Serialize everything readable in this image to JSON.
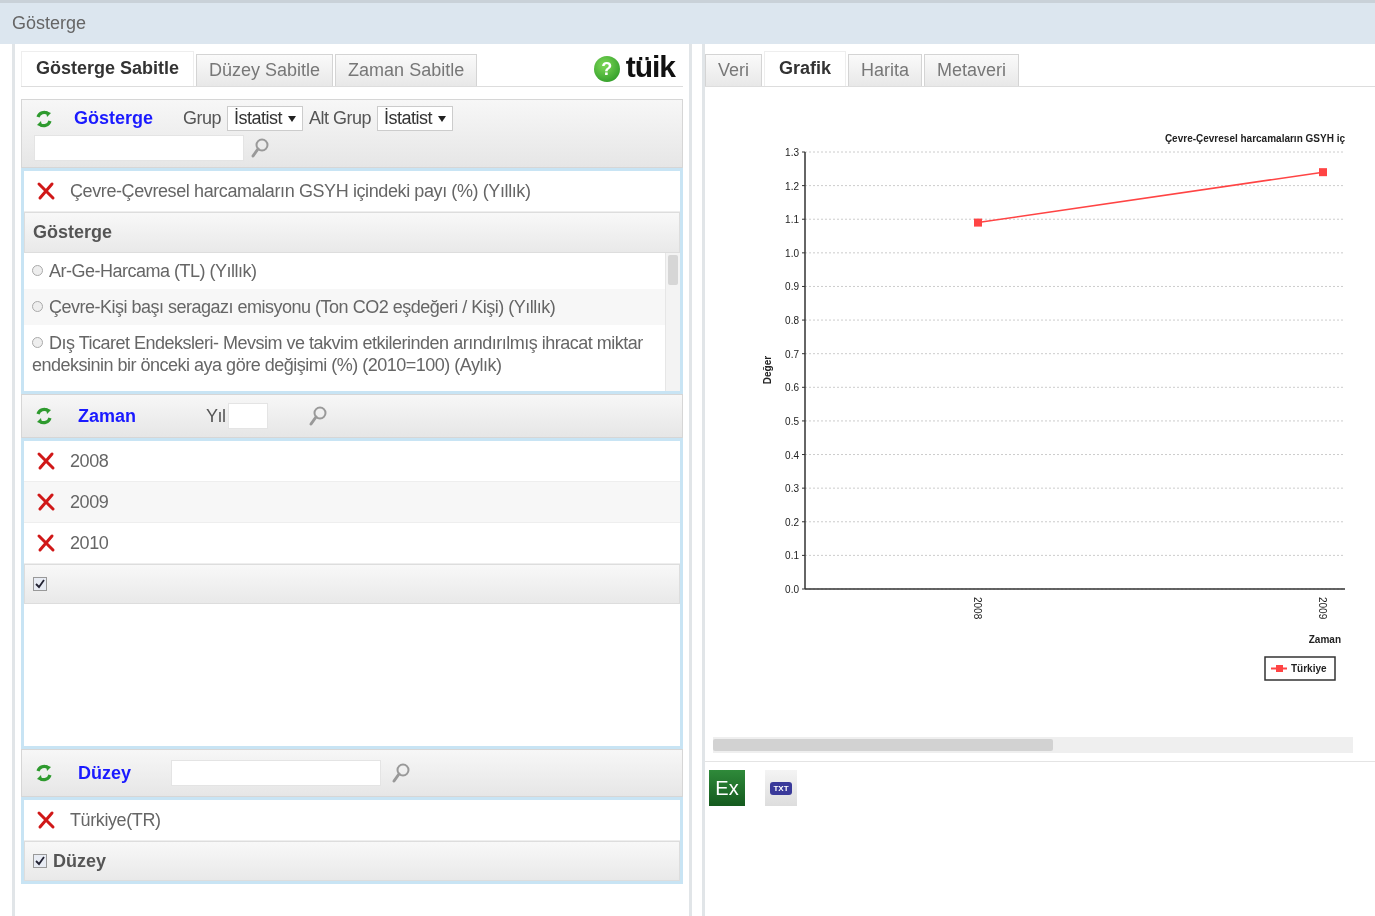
{
  "window": {
    "title": "Gösterge"
  },
  "left_tabs": [
    {
      "label": "Gösterge Sabitle",
      "selected": true
    },
    {
      "label": "Düzey Sabitle",
      "selected": false
    },
    {
      "label": "Zaman Sabitle",
      "selected": false
    }
  ],
  "help": "?",
  "logo": "tüik",
  "indicator_section": {
    "title": "Gösterge",
    "group_label": "Grup",
    "group_value": "İstatist",
    "subgroup_label": "Alt Grup",
    "subgroup_value": "İstatist",
    "selected_items": [
      {
        "label": "Çevre-Çevresel harcamaların GSYH içindeki payı (%) (Yıllık)"
      }
    ],
    "list_header": "Gösterge",
    "options": [
      {
        "label": "Ar-Ge-Harcama (TL) (Yıllık)",
        "selected": false
      },
      {
        "label": "Çevre-Kişi başı seragazı emisyonu (Ton CO2 eşdeğeri / Kişi) (Yıllık)",
        "selected": false
      },
      {
        "label": "Dış Ticaret Endeksleri- Mevsim ve takvim etkilerinden arındırılmış ihracat miktar endeksinin bir önceki aya göre değişimi (%) (2010=100) (Aylık)",
        "selected": false
      }
    ]
  },
  "time_section": {
    "title": "Zaman",
    "year_label": "Yıl",
    "selected_items": [
      {
        "label": "2008"
      },
      {
        "label": "2009"
      },
      {
        "label": "2010"
      }
    ],
    "select_all": {
      "checked": true
    }
  },
  "level_section": {
    "title": "Düzey",
    "selected_items": [
      {
        "label": "Türkiye(TR)"
      }
    ],
    "group": {
      "label": "Düzey",
      "checked": true
    }
  },
  "right_tabs": [
    {
      "label": "Veri",
      "selected": false
    },
    {
      "label": "Grafik",
      "selected": true
    },
    {
      "label": "Harita",
      "selected": false
    },
    {
      "label": "Metaveri",
      "selected": false
    }
  ],
  "chart_data": {
    "type": "line",
    "grid": true,
    "title": "Çevre-Çevresel harcamaların GSYH iç",
    "xlabel": "Zaman",
    "ylabel": "Değer",
    "categories": [
      "2008",
      "2009"
    ],
    "series": [
      {
        "name": "Türkiye",
        "color": "#ff4444",
        "marker": "square",
        "values": [
          1.09,
          1.24
        ]
      }
    ],
    "ylim": [
      0,
      1.3
    ],
    "yticks": [
      {
        "value": 0,
        "label": "0.0"
      },
      {
        "value": 0.1,
        "label": "0.1"
      },
      {
        "value": 0.2,
        "label": "0.2"
      },
      {
        "value": 0.3,
        "label": "0.3"
      },
      {
        "value": 0.4,
        "label": "0.4"
      },
      {
        "value": 0.5,
        "label": "0.5"
      },
      {
        "value": 0.6,
        "label": "0.6"
      },
      {
        "value": 0.7,
        "label": "0.7"
      },
      {
        "value": 0.8,
        "label": "0.8"
      },
      {
        "value": 0.9,
        "label": "0.9"
      },
      {
        "value": 1,
        "label": "1.0"
      },
      {
        "value": 1.1,
        "label": "1.1"
      },
      {
        "value": 1.2,
        "label": "1.2"
      },
      {
        "value": 1.3,
        "label": "1.3"
      }
    ]
  },
  "export_buttons": [
    {
      "kind": "excel",
      "label": "Ex"
    },
    {
      "kind": "txt",
      "label": "TXT"
    }
  ]
}
